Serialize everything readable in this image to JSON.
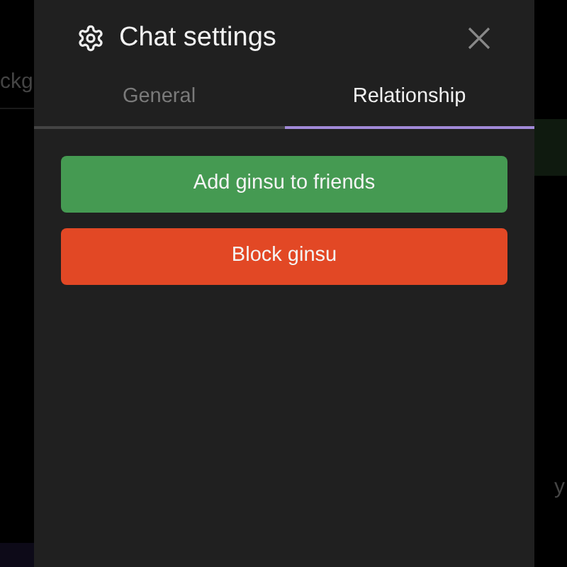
{
  "background": {
    "left_text": "ckg",
    "right_text": "y"
  },
  "dialog": {
    "title": "Chat settings",
    "tabs": [
      {
        "label": "General",
        "selected": false
      },
      {
        "label": "Relationship",
        "selected": true
      }
    ],
    "actions": [
      {
        "label": "Add ginsu to friends",
        "kind": "friend"
      },
      {
        "label": "Block ginsu",
        "kind": "block"
      }
    ]
  }
}
